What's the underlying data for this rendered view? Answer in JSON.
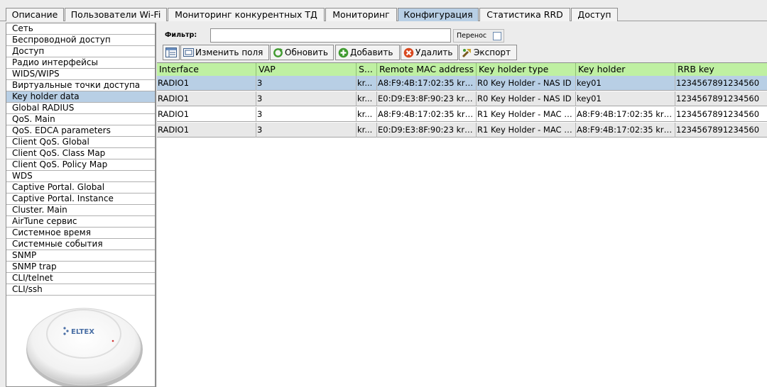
{
  "tabs": [
    "Описание",
    "Пользователи Wi-Fi",
    "Мониторинг конкурентных ТД",
    "Мониторинг",
    "Конфигурация",
    "Статистика RRD",
    "Доступ"
  ],
  "active_tab": "Конфигурация",
  "sidebar": {
    "items": [
      "Сеть",
      "Беспроводной доступ",
      "Доступ",
      "Радио интерфейсы",
      "WIDS/WIPS",
      "Виртуальные точки доступа",
      "Key holder data",
      "Global RADIUS",
      "QoS. Main",
      "QoS. EDCA parameters",
      "Client QoS. Global",
      "Client QoS. Class Map",
      "Client QoS. Policy Map",
      "WDS",
      "Captive Portal. Global",
      "Captive Portal. Instance",
      "Cluster. Main",
      "AirTune сервис",
      "Системное время",
      "Системные события",
      "SNMP",
      "SNMP trap",
      "CLI/telnet",
      "CLI/ssh"
    ],
    "active_item": "Key holder data",
    "device_logo": "ELTEX"
  },
  "filter": {
    "label": "Фильтр:",
    "value": "",
    "wrap_label": "Перенос"
  },
  "toolbar": {
    "change_fields": "Изменить поля",
    "refresh": "Обновить",
    "add": "Добавить",
    "delete": "Удалить",
    "export": "Экспорт"
  },
  "table": {
    "columns": [
      "Interface",
      "VAP",
      "S...",
      "Remote MAC address",
      "Key holder type",
      "Key holder",
      "RRB key"
    ],
    "rows": [
      [
        "RADIO1",
        "3",
        "kr...",
        "A8:F9:4B:17:02:35 kra...",
        "R0 Key Holder - NAS ID",
        "key01",
        "1234567891234560"
      ],
      [
        "RADIO1",
        "3",
        "kr...",
        "E0:D9:E3:8F:90:23 kra...",
        "R0 Key Holder - NAS ID",
        "key01",
        "1234567891234560"
      ],
      [
        "RADIO1",
        "3",
        "kr...",
        "A8:F9:4B:17:02:35 kra...",
        "R1 Key Holder - MAC A...",
        "A8:F9:4B:17:02:35 kra...",
        "1234567891234560"
      ],
      [
        "RADIO1",
        "3",
        "kr...",
        "E0:D9:E3:8F:90:23 kra...",
        "R1 Key Holder - MAC A...",
        "A8:F9:4B:17:02:35 kra...",
        "1234567891234560"
      ]
    ]
  },
  "colors": {
    "header_bg": "#bff0a2",
    "selected_bg": "#b8cfe5",
    "alt_row_bg": "#e8e8e8"
  }
}
